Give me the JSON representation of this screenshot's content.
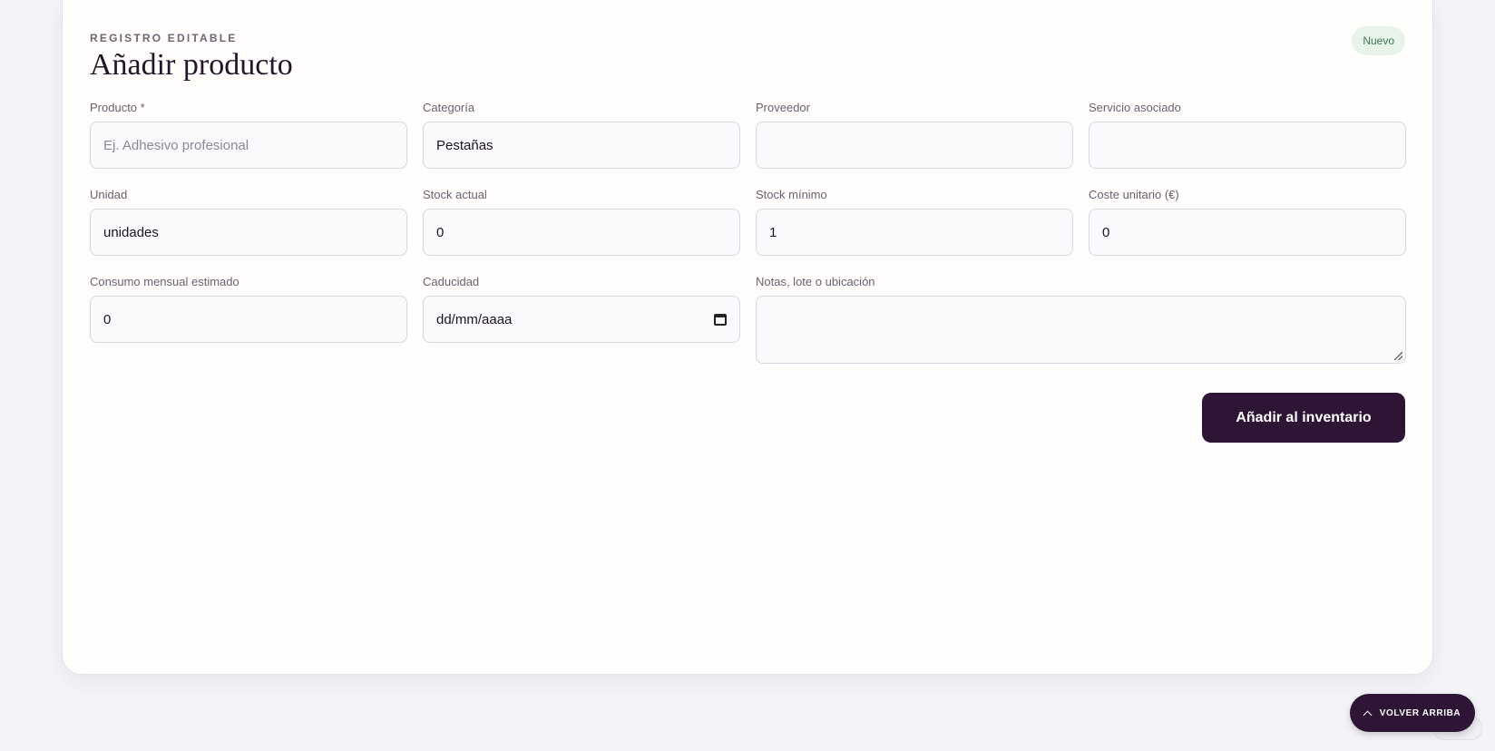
{
  "header": {
    "eyebrow": "REGISTRO EDITABLE",
    "title": "Añadir producto",
    "badge": "Nuevo"
  },
  "fields": {
    "producto": {
      "label": "Producto *",
      "value": "",
      "placeholder": "Ej. Adhesivo profesional"
    },
    "categoria": {
      "label": "Categoría",
      "value": "Pestañas"
    },
    "proveedor": {
      "label": "Proveedor",
      "value": ""
    },
    "servicio": {
      "label": "Servicio asociado",
      "value": ""
    },
    "unidad": {
      "label": "Unidad",
      "value": "unidades"
    },
    "stock_actual": {
      "label": "Stock actual",
      "value": "0"
    },
    "stock_minimo": {
      "label": "Stock mínimo",
      "value": "1"
    },
    "coste": {
      "label": "Coste unitario (€)",
      "value": "0"
    },
    "consumo": {
      "label": "Consumo mensual estimado",
      "value": "0"
    },
    "caducidad": {
      "label": "Caducidad",
      "value": "dd/mm/aaaa",
      "icon": "calendar-icon"
    },
    "notas": {
      "label": "Notas, lote o ubicación",
      "value": ""
    }
  },
  "actions": {
    "submit_label": "Añadir al inventario",
    "back_top_label": "VOLVER ARRIBA",
    "back_top_icon": "chevron-up-icon"
  },
  "colors": {
    "primary": "#2e1435",
    "badge_bg": "#e8f4ea",
    "badge_text": "#3f7550",
    "page_bg": "#f4f3f7"
  }
}
